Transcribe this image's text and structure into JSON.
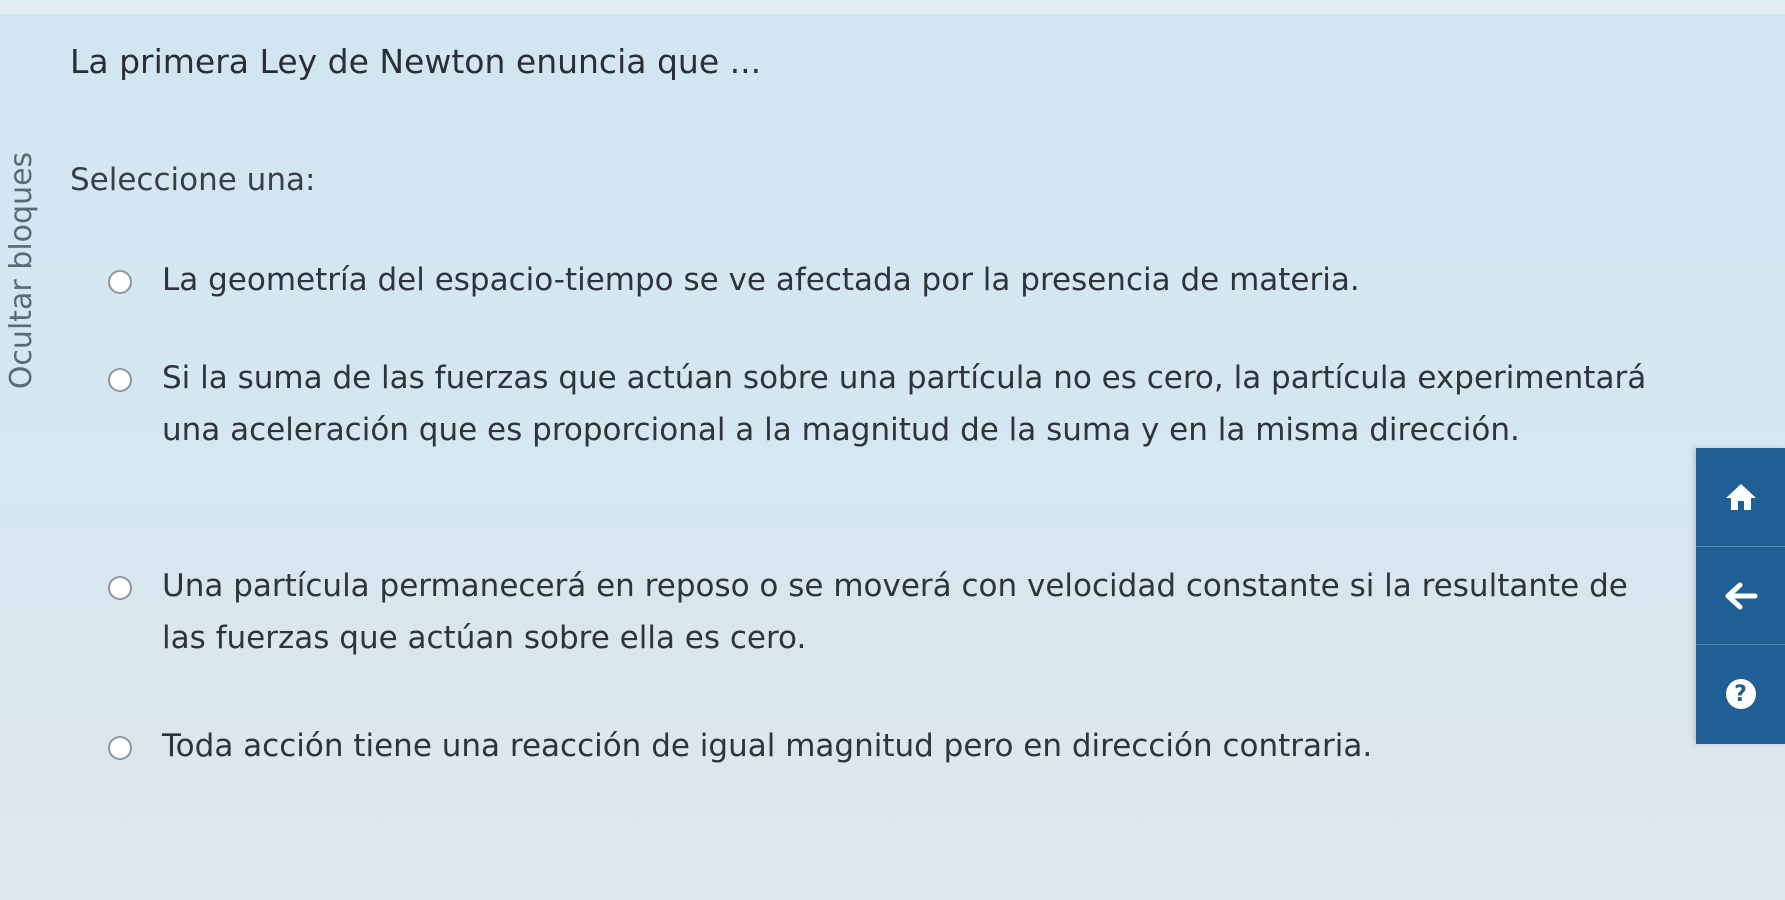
{
  "sidebar": {
    "hide_blocks_label": "Ocultar bloques"
  },
  "question": {
    "text": "La primera Ley de Newton enuncia que ...",
    "prompt": "Seleccione una:",
    "options": [
      {
        "label": "La geometría del espacio-tiempo se ve afectada por la presencia de materia."
      },
      {
        "label": "Si la suma de las fuerzas que actúan sobre una partícula no es cero, la partícula experimentará una aceleración que es proporcional a la magnitud de la suma y en la misma dirección."
      },
      {
        "label": "Una partícula permanecerá en reposo o se moverá con velocidad constante si la resultante de las fuerzas que actúan sobre ella es cero."
      },
      {
        "label": "Toda acción tiene una reacción de igual magnitud pero en dirección contraria."
      }
    ]
  },
  "side_nav": {
    "buttons": [
      {
        "icon": "home-icon"
      },
      {
        "icon": "arrow-left-icon"
      },
      {
        "icon": "help-icon",
        "glyph": "?"
      }
    ]
  }
}
